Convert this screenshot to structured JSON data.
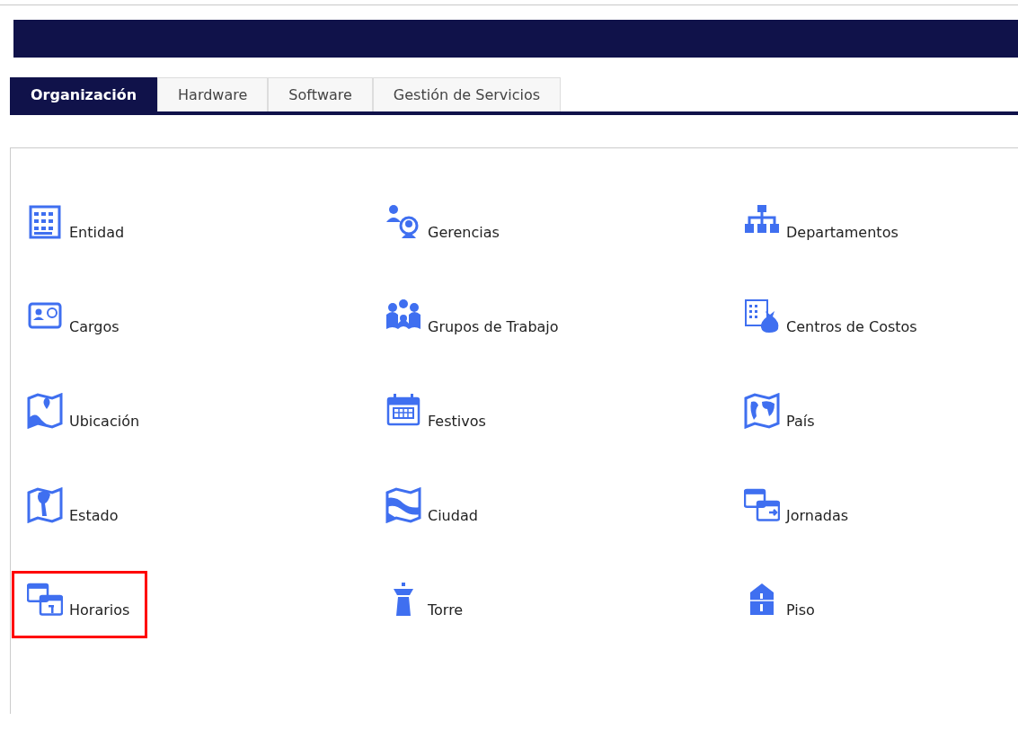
{
  "tabs": [
    {
      "label": "Organización",
      "selected": true
    },
    {
      "label": "Hardware",
      "selected": false
    },
    {
      "label": "Software",
      "selected": false
    },
    {
      "label": "Gestión de Servicios",
      "selected": false
    }
  ],
  "modules": [
    {
      "label": "Entidad",
      "kind": "building",
      "highlighted": false
    },
    {
      "label": "Gerencias",
      "kind": "managers",
      "highlighted": false
    },
    {
      "label": "Departamentos",
      "kind": "orgchart",
      "highlighted": false
    },
    {
      "label": "Cargos",
      "kind": "idcard",
      "highlighted": false
    },
    {
      "label": "Grupos de Trabajo",
      "kind": "group",
      "highlighted": false
    },
    {
      "label": "Centros de Costos",
      "kind": "cost",
      "highlighted": false
    },
    {
      "label": "Ubicación",
      "kind": "mappin",
      "highlighted": false
    },
    {
      "label": "Festivos",
      "kind": "calendar",
      "highlighted": false
    },
    {
      "label": "País",
      "kind": "worldmap",
      "highlighted": false
    },
    {
      "label": "Estado",
      "kind": "regionmap",
      "highlighted": false
    },
    {
      "label": "Ciudad",
      "kind": "citymap",
      "highlighted": false
    },
    {
      "label": "Jornadas",
      "kind": "calendararrow",
      "highlighted": false
    },
    {
      "label": "Horarios",
      "kind": "calendars",
      "highlighted": true
    },
    {
      "label": "Torre",
      "kind": "tower",
      "highlighted": false
    },
    {
      "label": "Piso",
      "kind": "floor",
      "highlighted": false
    }
  ]
}
